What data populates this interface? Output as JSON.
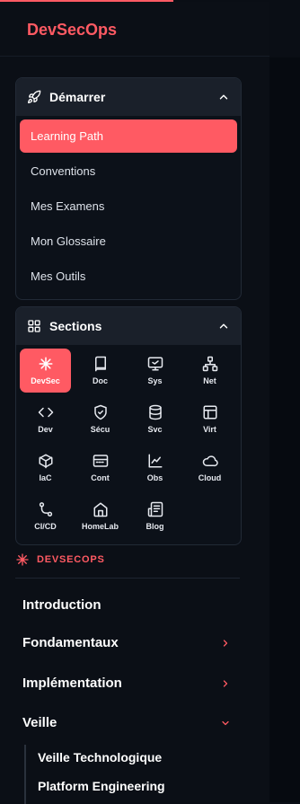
{
  "brand": "DevSecOps",
  "demarrer": {
    "title": "Démarrer",
    "items": [
      {
        "label": "Learning Path",
        "active": true
      },
      {
        "label": "Conventions"
      },
      {
        "label": "Mes Examens"
      },
      {
        "label": "Mon Glossaire"
      },
      {
        "label": "Mes Outils"
      }
    ]
  },
  "sections": {
    "title": "Sections",
    "items": [
      {
        "label": "DevSec",
        "icon": "asterisk-icon",
        "active": true
      },
      {
        "label": "Doc",
        "icon": "book-icon"
      },
      {
        "label": "Sys",
        "icon": "monitor-icon"
      },
      {
        "label": "Net",
        "icon": "network-icon"
      },
      {
        "label": "Dev",
        "icon": "code-icon"
      },
      {
        "label": "Sécu",
        "icon": "shield-check-icon"
      },
      {
        "label": "Svc",
        "icon": "database-icon"
      },
      {
        "label": "Virt",
        "icon": "layout-icon"
      },
      {
        "label": "IaC",
        "icon": "box-icon"
      },
      {
        "label": "Cont",
        "icon": "container-icon"
      },
      {
        "label": "Obs",
        "icon": "chart-line-icon"
      },
      {
        "label": "Cloud",
        "icon": "cloud-icon"
      },
      {
        "label": "CI/CD",
        "icon": "git-branch-icon"
      },
      {
        "label": "HomeLab",
        "icon": "home-icon"
      },
      {
        "label": "Blog",
        "icon": "newspaper-icon"
      }
    ]
  },
  "nav_section_label": "DEVSECOPS",
  "nav": [
    {
      "label": "Introduction",
      "chevron": "none"
    },
    {
      "label": "Fondamentaux",
      "chevron": "right"
    },
    {
      "label": "Implémentation",
      "chevron": "right"
    },
    {
      "label": "Veille",
      "chevron": "down"
    }
  ],
  "veille_items": [
    "Veille Technologique",
    "Platform Engineering"
  ],
  "colors": {
    "accent": "#ff5a63",
    "panel_header": "#1a202a",
    "background": "#0b0f16"
  }
}
